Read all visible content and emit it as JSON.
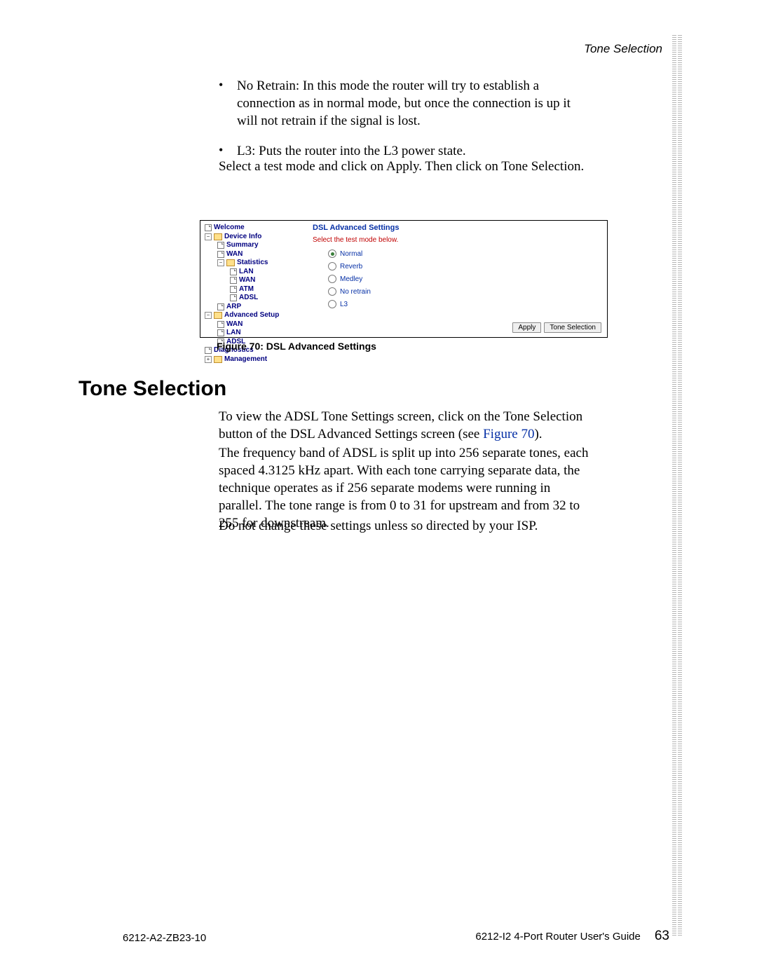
{
  "header": {
    "title": "Tone Selection"
  },
  "body": {
    "bullets": [
      "No Retrain: In this mode the router will try to establish a connection as in normal mode, but once the connection is up it will not retrain if the signal is lost.",
      "L3: Puts the router into the L3 power state."
    ],
    "instruction": "Select a test mode and click on Apply. Then click on Tone Selection."
  },
  "figure": {
    "caption": "Figure 70: DSL Advanced Settings",
    "tree": [
      "Welcome",
      "Device Info",
      "Summary",
      "WAN",
      "Statistics",
      "LAN",
      "WAN",
      "ATM",
      "ADSL",
      "ARP",
      "Advanced Setup",
      "WAN",
      "LAN",
      "ADSL",
      "Diagnostics",
      "Management"
    ],
    "panel": {
      "title": "DSL Advanced Settings",
      "instruction": "Select the test mode below.",
      "options": [
        "Normal",
        "Reverb",
        "Medley",
        "No retrain",
        "L3"
      ],
      "buttons": [
        "Apply",
        "Tone Selection"
      ]
    }
  },
  "section": {
    "heading": "Tone Selection",
    "p1a": "To view the ADSL Tone Settings screen, click on the Tone Selection button of the DSL Advanced Settings screen (see ",
    "xref": "Figure 70",
    "p1b": ").",
    "p2": "The frequency band of ADSL is split up into 256 separate tones, each spaced 4.3125 kHz apart. With each tone carrying separate data, the technique operates as if 256 separate modems were running in parallel. The tone range is from 0 to 31 for upstream and from 32 to 255 for downstream.",
    "p3": "Do not change these settings unless so directed by your ISP."
  },
  "footer": {
    "left": "6212-A2-ZB23-10",
    "right": "6212-I2 4-Port Router User's Guide",
    "page": "63"
  }
}
